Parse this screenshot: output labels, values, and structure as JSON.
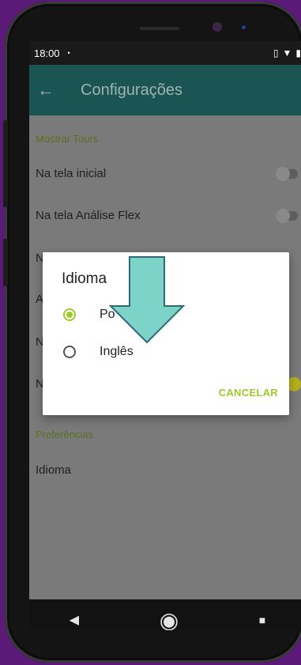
{
  "status": {
    "time": "18:00",
    "dot": "•",
    "icons": [
      "vibrate-icon",
      "wifi-icon",
      "battery-icon"
    ]
  },
  "appbar": {
    "back_icon": "←",
    "title": "Configurações"
  },
  "sections": {
    "tours": "Mostrar Tours",
    "preferences": "Preferências"
  },
  "rows": {
    "initial": "Na tela inicial",
    "flex": "Na tela Análise Flex",
    "row3_partial": "N",
    "row4_partial": "A",
    "row5_partial": "N",
    "row6_partial": "N",
    "language": "Idioma"
  },
  "dialog": {
    "title": "Idioma",
    "options": [
      {
        "label": "Po",
        "selected": true
      },
      {
        "label": "Inglês",
        "selected": false
      }
    ],
    "cancel": "CANCELAR"
  },
  "colors": {
    "accent": "#9ccb2b",
    "appbar": "#1a5553",
    "arrow": "#7ed3c8",
    "background": "#5b1a78"
  },
  "navbar": {
    "back": "◀",
    "home": "◉",
    "recents": "■"
  }
}
